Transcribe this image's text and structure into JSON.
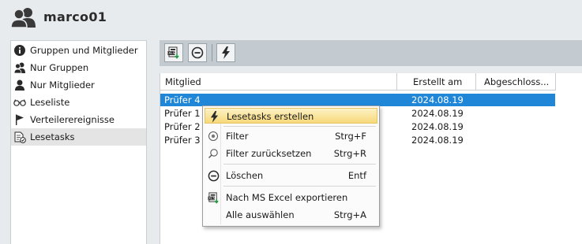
{
  "header": {
    "title": "marco01",
    "icon": "user-group-icon"
  },
  "sidebar": {
    "items": [
      {
        "label": "Gruppen und Mitglieder",
        "icon": "info-icon"
      },
      {
        "label": "Nur Gruppen",
        "icon": "users-icon"
      },
      {
        "label": "Nur Mitglieder",
        "icon": "user-icon"
      },
      {
        "label": "Leseliste",
        "icon": "glasses-icon"
      },
      {
        "label": "Verteilerereignisse",
        "icon": "flag-icon"
      },
      {
        "label": "Lesetasks",
        "icon": "document-check-icon",
        "active": true
      }
    ]
  },
  "toolbar": {
    "buttons": [
      {
        "name": "excel-export-button",
        "icon": "excel-export-icon"
      },
      {
        "name": "delete-button",
        "icon": "minus-circle-icon"
      },
      {
        "name": "create-task-button",
        "icon": "lightning-icon"
      }
    ]
  },
  "table": {
    "columns": [
      "Mitglied",
      "Erstellt am",
      "Abgeschloss..."
    ],
    "rows": [
      {
        "member": "Prüfer 4",
        "created": "2024.08.19",
        "done": "",
        "selected": true
      },
      {
        "member": "Prüfer 1",
        "created": "2024.08.19",
        "done": ""
      },
      {
        "member": "Prüfer 2",
        "created": "2024.08.19",
        "done": ""
      },
      {
        "member": "Prüfer 3",
        "created": "2024.08.19",
        "done": ""
      }
    ]
  },
  "context_menu": {
    "items": [
      {
        "label": "Lesetasks erstellen",
        "shortcut": "",
        "icon": "lightning-icon",
        "highlighted": true
      },
      {
        "label": "Filter",
        "shortcut": "Strg+F",
        "icon": "filter-icon"
      },
      {
        "label": "Filter zurücksetzen",
        "shortcut": "Strg+R",
        "icon": "search-icon"
      },
      {
        "label": "Löschen",
        "shortcut": "Entf",
        "icon": "minus-circle-icon"
      },
      {
        "label": "Nach MS Excel exportieren",
        "shortcut": "",
        "icon": "excel-export-icon"
      },
      {
        "label": "Alle auswählen",
        "shortcut": "Strg+A",
        "icon": ""
      }
    ]
  },
  "colors": {
    "selection": "#1f86d8",
    "menu_highlight": "#f7d97a",
    "toolbar_bg": "#c3cbd0"
  }
}
